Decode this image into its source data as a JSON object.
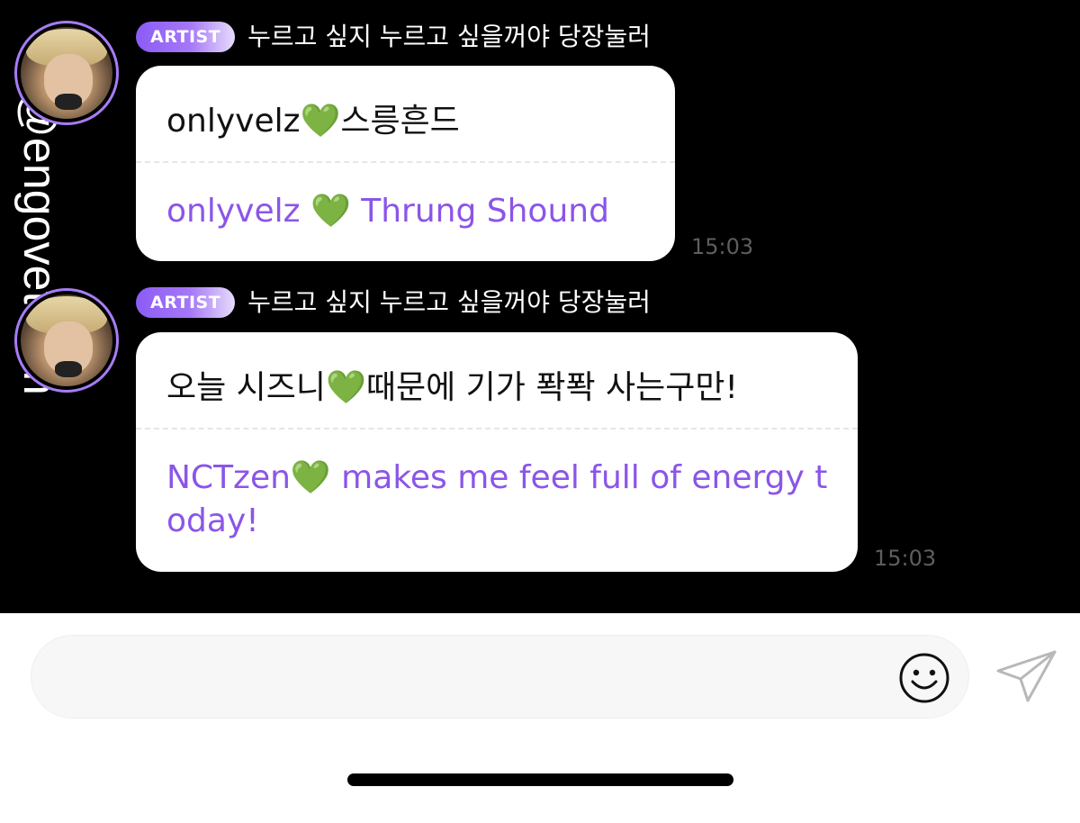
{
  "watermark": "@engoveteam",
  "messages": [
    {
      "badge": "ARTIST",
      "sender": "누르고 싶지 누르고 싶을꺼야 당장눌러",
      "original": "onlyvelz💚스릉흔드",
      "translation": "onlyvelz 💚 Thrung Shound",
      "time": "15:03"
    },
    {
      "badge": "ARTIST",
      "sender": "누르고 싶지 누르고 싶을꺼야 당장눌러",
      "original": "오늘 시즈니💚때문에 기가 퐉퐉 사는구만!",
      "translation": "NCTzen💚 makes me feel full of energy today!",
      "time": "15:03"
    }
  ],
  "composer": {
    "placeholder": "",
    "emoji_icon": "smiley-icon",
    "send_icon": "paper-plane-icon"
  },
  "colors": {
    "badge": "#8b5cf6",
    "translation": "#8b55e8",
    "heart": "#3cbf3c",
    "background": "#000000"
  }
}
